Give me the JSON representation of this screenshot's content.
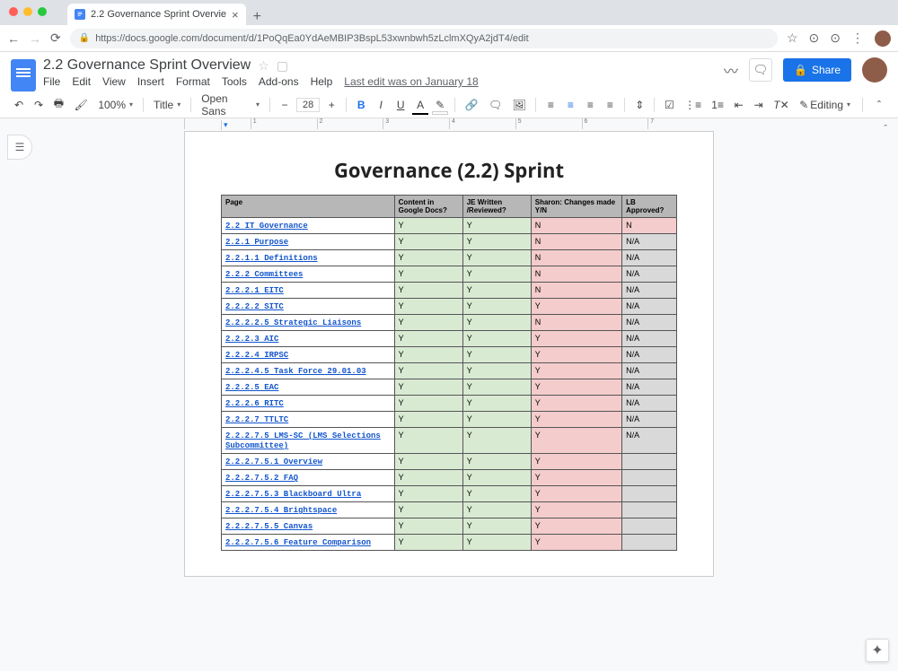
{
  "browser": {
    "tab_title": "2.2 Governance Sprint Overvie",
    "url": "https://docs.google.com/document/d/1PoQqEa0YdAeMBIP3BspL53xwnbwh5zLclmXQyA2jdT4/edit"
  },
  "docs": {
    "title": "2.2 Governance Sprint Overview",
    "menu": [
      "File",
      "Edit",
      "View",
      "Insert",
      "Format",
      "Tools",
      "Add-ons",
      "Help"
    ],
    "last_edit": "Last edit was on January 18",
    "share": "Share",
    "toolbar": {
      "zoom": "100%",
      "style": "Title",
      "font": "Open Sans",
      "size": "28",
      "editing": "Editing"
    }
  },
  "document": {
    "heading": "Governance (2.2) Sprint",
    "columns": [
      "Page",
      "Content in Google Docs?",
      "JE Written /Reviewed?",
      "Sharon: Changes made Y/N",
      "LB Approved?"
    ],
    "rows": [
      {
        "page": "2.2 IT Governance",
        "c1": "Y",
        "c2": "Y",
        "c3": "N",
        "c4": "N"
      },
      {
        "page": "2.2.1 Purpose",
        "c1": "Y",
        "c2": "Y",
        "c3": "N",
        "c4": "N/A"
      },
      {
        "page": "2.2.1.1 Definitions",
        "c1": "Y",
        "c2": "Y",
        "c3": "N",
        "c4": "N/A"
      },
      {
        "page": "2.2.2 Committees",
        "c1": "Y",
        "c2": "Y",
        "c3": "N",
        "c4": "N/A"
      },
      {
        "page": "2.2.2.1 EITC",
        "c1": "Y",
        "c2": "Y",
        "c3": "N",
        "c4": "N/A"
      },
      {
        "page": "2.2.2.2 SITC",
        "c1": "Y",
        "c2": "Y",
        "c3": "Y",
        "c4": "N/A"
      },
      {
        "page": "2.2.2.2.5 Strategic Liaisons",
        "c1": "Y",
        "c2": "Y",
        "c3": "N",
        "c4": "N/A"
      },
      {
        "page": "2.2.2.3 AIC",
        "c1": "Y",
        "c2": "Y",
        "c3": "Y",
        "c4": "N/A"
      },
      {
        "page": "2.2.2.4 IRPSC",
        "c1": "Y",
        "c2": "Y",
        "c3": "Y",
        "c4": "N/A"
      },
      {
        "page": "2.2.2.4.5 Task Force 29.01.03",
        "c1": "Y",
        "c2": "Y",
        "c3": "Y",
        "c4": "N/A"
      },
      {
        "page": "2.2.2.5 EAC",
        "c1": "Y",
        "c2": "Y",
        "c3": "Y",
        "c4": "N/A"
      },
      {
        "page": "2.2.2.6 RITC",
        "c1": "Y",
        "c2": "Y",
        "c3": "Y",
        "c4": "N/A"
      },
      {
        "page": "2.2.2.7 TTLTC",
        "c1": "Y",
        "c2": "Y",
        "c3": "Y",
        "c4": "N/A"
      },
      {
        "page": "2.2.2.7.5 LMS-SC (LMS Selections Subcommittee)",
        "c1": "Y",
        "c2": "Y",
        "c3": "Y",
        "c4": "N/A"
      },
      {
        "page": "2.2.2.7.5.1 Overview",
        "c1": "Y",
        "c2": "Y",
        "c3": "Y",
        "c4": ""
      },
      {
        "page": "2.2.2.7.5.2 FAQ",
        "c1": "Y",
        "c2": "Y",
        "c3": "Y",
        "c4": ""
      },
      {
        "page": "2.2.2.7.5.3 Blackboard Ultra",
        "c1": "Y",
        "c2": "Y",
        "c3": "Y",
        "c4": ""
      },
      {
        "page": "2.2.2.7.5.4 Brightspace",
        "c1": "Y",
        "c2": "Y",
        "c3": "Y",
        "c4": ""
      },
      {
        "page": "2.2.2.7.5.5 Canvas",
        "c1": "Y",
        "c2": "Y",
        "c3": "Y",
        "c4": ""
      },
      {
        "page": "2.2.2.7.5.6 Feature Comparison",
        "c1": "Y",
        "c2": "Y",
        "c3": "Y",
        "c4": ""
      }
    ]
  },
  "ruler": [
    "",
    "1",
    "2",
    "3",
    "4",
    "5",
    "6",
    "7"
  ]
}
